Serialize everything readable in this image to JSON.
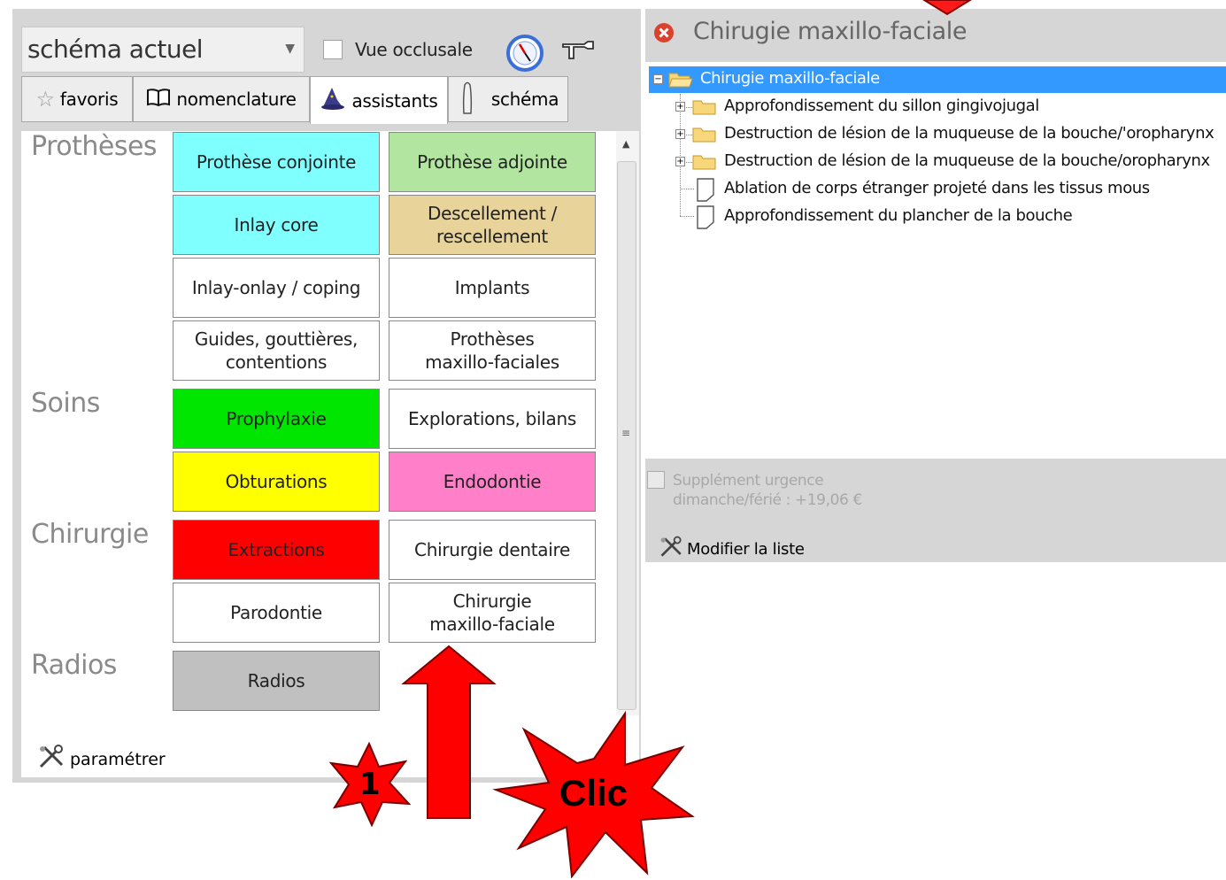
{
  "left_panel": {
    "schema_select": "schéma actuel",
    "vue_occlusale": "Vue occlusale",
    "tabs": [
      {
        "label": "favoris"
      },
      {
        "label": "nomenclature"
      },
      {
        "label": "assistants"
      },
      {
        "label": "schéma"
      }
    ],
    "sections": {
      "protheses": "Prothèses",
      "soins": "Soins",
      "chirurgie": "Chirurgie",
      "radios": "Radios"
    },
    "tiles": {
      "prothese_conjointe": "Prothèse conjointe",
      "prothese_adjointe": "Prothèse adjointe",
      "inlay_core": "Inlay core",
      "descellement_1": "Descellement /",
      "descellement_2": "rescellement",
      "inlay_onlay": "Inlay-onlay / coping",
      "implants": "Implants",
      "guides_1": "Guides, gouttières,",
      "guides_2": "contentions",
      "protheses_mf_1": "Prothèses",
      "protheses_mf_2": "maxillo-faciales",
      "prophylaxie": "Prophylaxie",
      "explorations": "Explorations, bilans",
      "obturations": "Obturations",
      "endodontie": "Endodontie",
      "extractions": "Extractions",
      "chirurgie_dentaire": "Chirurgie dentaire",
      "parodontie": "Parodontie",
      "chirurgie_mf_1": "Chirurgie",
      "chirurgie_mf_2": "maxillo-faciale",
      "radios": "Radios"
    },
    "parametrer": "paramétrer"
  },
  "right_panel": {
    "title": "Chirugie maxillo-faciale",
    "tree": {
      "root": "Chirugie maxillo-faciale",
      "items": [
        {
          "label": "Approfondissement du sillon gingivojugal",
          "type": "folder"
        },
        {
          "label": "Destruction de lésion de la muqueuse de la bouche/'oropharynx",
          "type": "folder"
        },
        {
          "label": "Destruction de lésion de la muqueuse de la bouche/oropharynx",
          "type": "folder"
        },
        {
          "label": "Ablation de corps étranger projeté dans les tissus mous",
          "type": "document"
        },
        {
          "label": "Approfondissement du plancher de la bouche",
          "type": "document"
        }
      ]
    },
    "supplement_line1": "Supplément urgence",
    "supplement_line2": "dimanche/férié : +19,06 €",
    "modifier_liste": "Modifier la liste"
  },
  "annotations": {
    "step_number": "1",
    "click_label": "Clic"
  },
  "colors": {
    "cyan": "#80ffff",
    "light_green": "#b2e6a0",
    "tan": "#e8d49a",
    "green": "#00e600",
    "yellow": "#ffff00",
    "pink": "#ff80c8",
    "red": "#ff0000",
    "gray": "#c0c0c0",
    "selection": "#3399ff"
  }
}
